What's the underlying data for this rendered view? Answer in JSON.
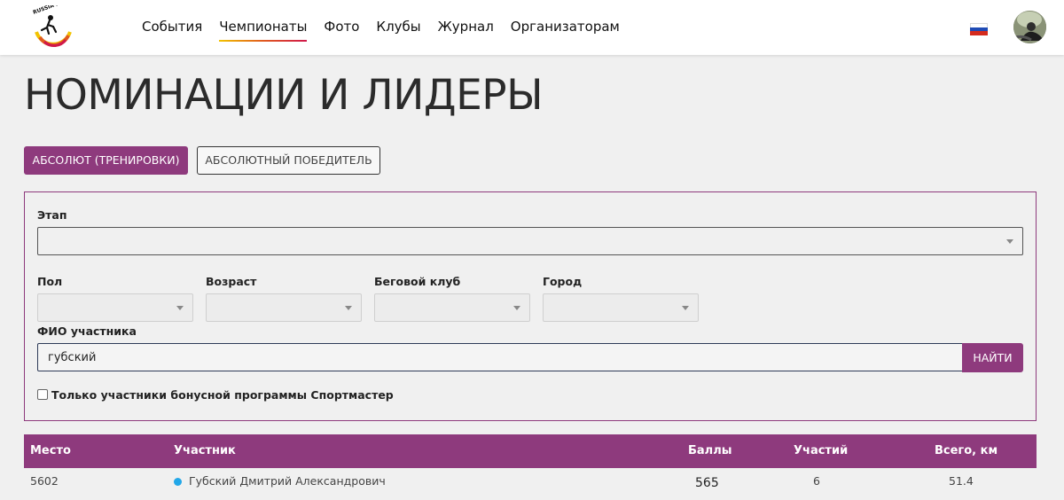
{
  "header": {
    "nav": [
      {
        "label": "События",
        "active": false
      },
      {
        "label": "Чемпионаты",
        "active": true
      },
      {
        "label": "Фото",
        "active": false
      },
      {
        "label": "Клубы",
        "active": false
      },
      {
        "label": "Журнал",
        "active": false
      },
      {
        "label": "Организаторам",
        "active": false
      }
    ],
    "logo_text": "RUSSIA RUNNING",
    "language": "ru"
  },
  "page": {
    "title": "НОМИНАЦИИ И ЛИДЕРЫ"
  },
  "tabs": [
    {
      "label": "АБСОЛЮТ (ТРЕНИРОВКИ)",
      "active": true
    },
    {
      "label": "АБСОЛЮТНЫЙ ПОБЕДИТЕЛЬ",
      "active": false
    }
  ],
  "filters": {
    "stage_label": "Этап",
    "stage_value": "",
    "gender_label": "Пол",
    "gender_value": "",
    "age_label": "Возраст",
    "age_value": "",
    "club_label": "Беговой клуб",
    "club_value": "",
    "city_label": "Город",
    "city_value": "",
    "name_label": "ФИО участника",
    "name_value": "губский",
    "search_button": "НАЙТИ",
    "bonus_checkbox_label": "Только участники бонусной программы Спортмастер",
    "bonus_checked": false
  },
  "table": {
    "columns": {
      "place": "Место",
      "participant": "Участник",
      "points": "Баллы",
      "participations": "Участий",
      "total_km": "Всего, км"
    },
    "rows": [
      {
        "place": "5602",
        "participant": "Губский Дмитрий Александрович",
        "points": "565",
        "participations": "6",
        "total_km": "51.4"
      }
    ]
  },
  "colors": {
    "accent": "#8e3a7d",
    "header_bg": "#ffffff",
    "page_bg": "#f0f0f0",
    "status_dot": "#22a7e8"
  }
}
